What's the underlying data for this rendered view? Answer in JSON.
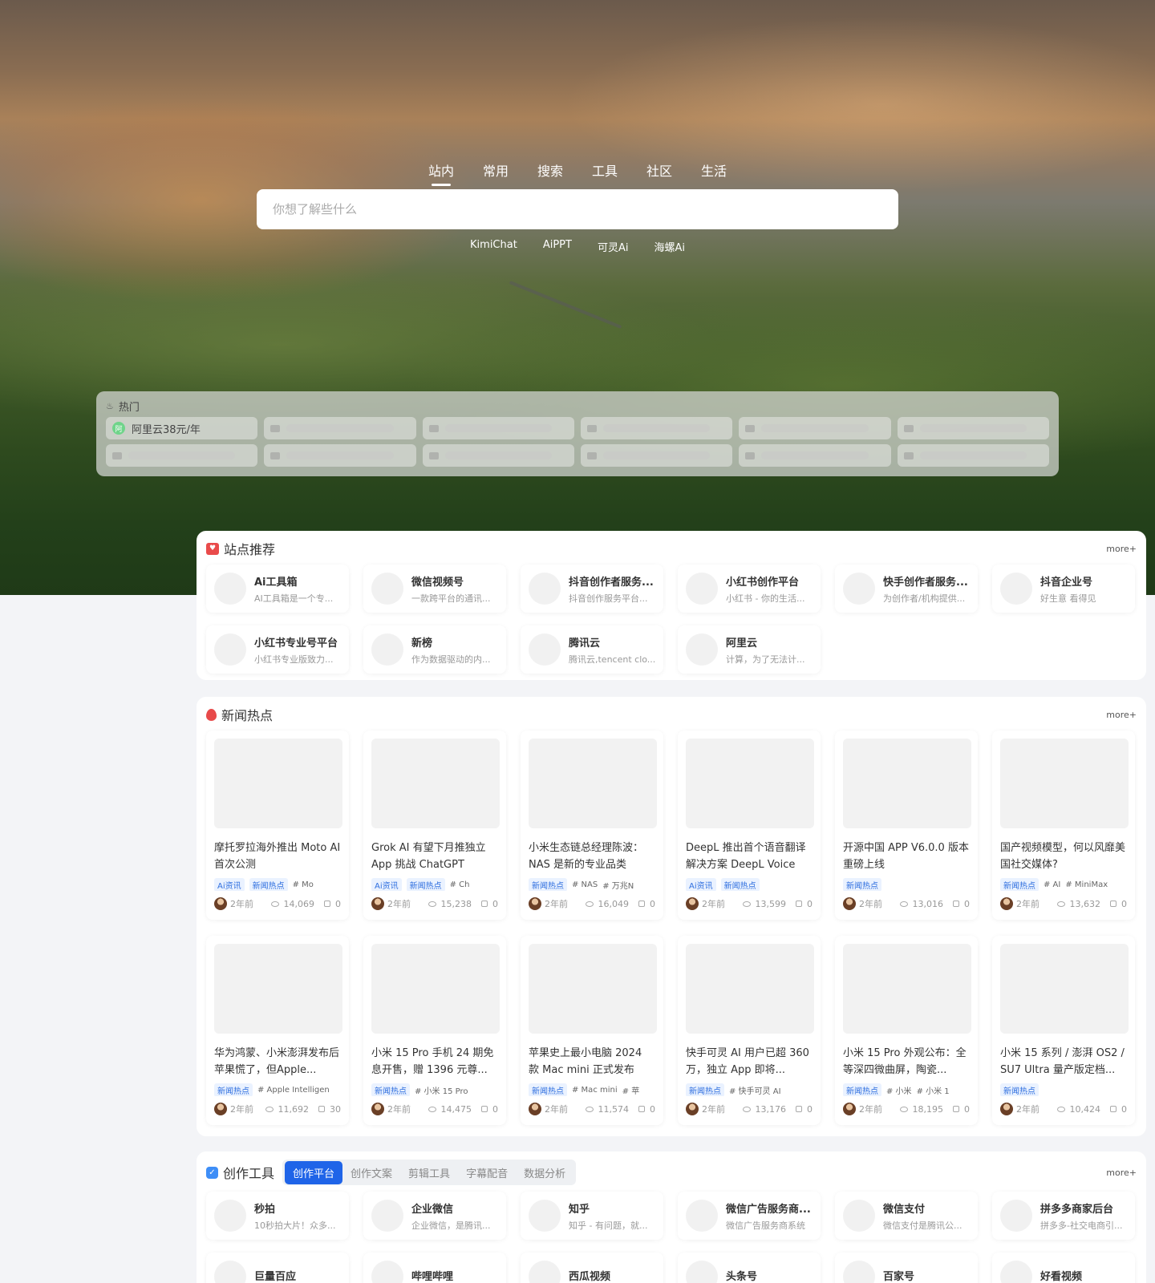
{
  "search": {
    "tabs": [
      "站内",
      "常用",
      "搜索",
      "工具",
      "社区",
      "生活"
    ],
    "active_tab": 0,
    "placeholder": "你想了解些什么",
    "quick_links": [
      "KimiChat",
      "AiPPT",
      "可灵Ai",
      "海螺Ai"
    ]
  },
  "hot": {
    "title": "热门",
    "first_item": {
      "badge": "阿",
      "label": "阿里云38元/年"
    }
  },
  "recommend": {
    "title": "站点推荐",
    "more": "more+",
    "sites": [
      {
        "name": "Ai工具箱",
        "desc": "AI工具箱是一个专..."
      },
      {
        "name": "微信视频号",
        "desc": "一款跨平台的通讯..."
      },
      {
        "name": "抖音创作者服务...",
        "desc": "抖音创作服务平台..."
      },
      {
        "name": "小红书创作平台",
        "desc": "小红书 - 你的生活..."
      },
      {
        "name": "快手创作者服务...",
        "desc": "为创作者/机构提供..."
      },
      {
        "name": "抖音企业号",
        "desc": "好生意 看得见"
      },
      {
        "name": "小红书专业号平台",
        "desc": "小红书专业版致力..."
      },
      {
        "name": "新榜",
        "desc": "作为数据驱动的内..."
      },
      {
        "name": "腾讯云",
        "desc": "腾讯云,tencent clo..."
      },
      {
        "name": "阿里云",
        "desc": "计算，为了无法计..."
      }
    ]
  },
  "news": {
    "title": "新闻热点",
    "more": "more+",
    "items": [
      {
        "title": "摩托罗拉海外推出 Moto AI 首次公测",
        "tags": [
          "Ai资讯",
          "新闻热点"
        ],
        "kws": [
          "# Mo"
        ],
        "time": "2年前",
        "views": "14,069",
        "likes": "0"
      },
      {
        "title": "Grok AI 有望下月推独立 App 挑战 ChatGPT",
        "tags": [
          "Ai资讯",
          "新闻热点"
        ],
        "kws": [
          "# Ch"
        ],
        "time": "2年前",
        "views": "15,238",
        "likes": "0"
      },
      {
        "title": "小米生态链总经理陈波：NAS 是新的专业品类",
        "tags": [
          "新闻热点"
        ],
        "kws": [
          "# NAS",
          "# 万兆N"
        ],
        "time": "2年前",
        "views": "16,049",
        "likes": "0"
      },
      {
        "title": "DeepL 推出首个语音翻译解决方案 DeepL Voice",
        "tags": [
          "Ai资讯",
          "新闻热点"
        ],
        "kws": [],
        "time": "2年前",
        "views": "13,599",
        "likes": "0"
      },
      {
        "title": "开源中国 APP V6.0.0 版本重磅上线",
        "tags": [
          "新闻热点"
        ],
        "kws": [],
        "time": "2年前",
        "views": "13,016",
        "likes": "0"
      },
      {
        "title": "国产视频模型，何以风靡美国社交媒体?",
        "tags": [
          "新闻热点"
        ],
        "kws": [
          "# AI",
          "# MiniMax"
        ],
        "time": "2年前",
        "views": "13,632",
        "likes": "0"
      },
      {
        "title": "华为鸿蒙、小米澎湃发布后苹果慌了，但Apple...",
        "tags": [
          "新闻热点"
        ],
        "kws": [
          "# Apple Intelligen"
        ],
        "time": "2年前",
        "views": "11,692",
        "likes": "30"
      },
      {
        "title": "小米 15 Pro 手机 24 期免息开售，赠 1396 元尊...",
        "tags": [
          "新闻热点"
        ],
        "kws": [
          "# 小米 15 Pro"
        ],
        "time": "2年前",
        "views": "14,475",
        "likes": "0"
      },
      {
        "title": "苹果史上最小电脑 2024 款 Mac mini 正式发布",
        "tags": [
          "新闻热点"
        ],
        "kws": [
          "# Mac mini",
          "# 苹"
        ],
        "time": "2年前",
        "views": "11,574",
        "likes": "0"
      },
      {
        "title": "快手可灵 AI 用户已超 360 万，独立 App 即将...",
        "tags": [
          "新闻热点"
        ],
        "kws": [
          "# 快手可灵 AI"
        ],
        "time": "2年前",
        "views": "13,176",
        "likes": "0"
      },
      {
        "title": "小米 15 Pro 外观公布：全等深四微曲屏，陶瓷...",
        "tags": [
          "新闻热点"
        ],
        "kws": [
          "# 小米",
          "# 小米 1"
        ],
        "time": "2年前",
        "views": "18,195",
        "likes": "0"
      },
      {
        "title": "小米 15 系列 / 澎湃 OS2 / SU7 Ultra 量产版定档...",
        "tags": [
          "新闻热点"
        ],
        "kws": [],
        "time": "2年前",
        "views": "10,424",
        "likes": "0"
      }
    ]
  },
  "tools": {
    "title": "创作工具",
    "more": "more+",
    "tabs": [
      "创作平台",
      "创作文案",
      "剪辑工具",
      "字幕配音",
      "数据分析"
    ],
    "active_tab": 0,
    "sites": [
      {
        "name": "秒拍",
        "desc": "10秒拍大片！众多..."
      },
      {
        "name": "企业微信",
        "desc": "企业微信，是腾讯..."
      },
      {
        "name": "知乎",
        "desc": "知乎 - 有问题，就..."
      },
      {
        "name": "微信广告服务商...",
        "desc": "微信广告服务商系统"
      },
      {
        "name": "微信支付",
        "desc": "微信支付是腾讯公..."
      },
      {
        "name": "拼多多商家后台",
        "desc": "拼多多-社交电商引..."
      },
      {
        "name": "巨量百应",
        "desc": ""
      },
      {
        "name": "哔哩哔哩",
        "desc": ""
      },
      {
        "name": "西瓜视频",
        "desc": ""
      },
      {
        "name": "头条号",
        "desc": ""
      },
      {
        "name": "百家号",
        "desc": ""
      },
      {
        "name": "好看视频",
        "desc": ""
      }
    ]
  }
}
